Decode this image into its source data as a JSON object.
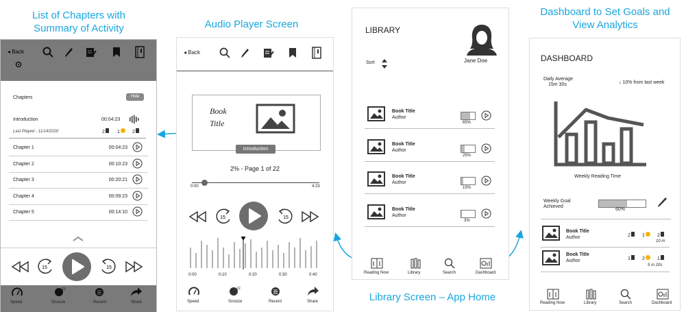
{
  "captions": {
    "chapters": "List of Chapters with\nSummary of Activity",
    "player": "Audio Player Screen",
    "library": "Library Screen – App Home",
    "dashboard": "Dashboard to Set Goals and\nView Analytics"
  },
  "chapters_screen": {
    "back": "Back",
    "title": "Chapters",
    "hide": "Hide",
    "intro": {
      "name": "Introduction",
      "time": "00:04:23",
      "last_played": "Last Played - 11/14/2020",
      "c1": "2",
      "c2": "1",
      "c3": "2"
    },
    "rows": [
      {
        "name": "Chapter 1",
        "time": "00:04:23"
      },
      {
        "name": "Chapter 2",
        "time": "00:10:23"
      },
      {
        "name": "Chapter 3",
        "time": "00:20:21"
      },
      {
        "name": "Chapter 4",
        "time": "00:09:23"
      },
      {
        "name": "Chapter 5",
        "time": "00:14:10"
      }
    ],
    "skip": "15",
    "bottom": [
      "Speed",
      "Snooze",
      "Recent",
      "Share"
    ]
  },
  "player_screen": {
    "back": "Back",
    "book_title": "Book\nTitle",
    "chapter_tag": "Introduction",
    "progress": "2%  - Page 1 of 22",
    "progress_fraction": 0.02,
    "start": "0:00",
    "end": "4:23",
    "skip": "15",
    "ticks": [
      "0:00",
      "0:10",
      "0:20",
      "0:30",
      "0:40"
    ],
    "bottom": [
      "Speed",
      "Snooze",
      "Recent",
      "Share"
    ]
  },
  "library_screen": {
    "title": "LIBRARY",
    "sort": "Sort",
    "user": "Jane Doe",
    "books": [
      {
        "title": "Book Title",
        "author": "Author",
        "pct": "65%",
        "frac": 0.65
      },
      {
        "title": "Book Title",
        "author": "Author",
        "pct": "25%",
        "frac": 0.25
      },
      {
        "title": "Book Title",
        "author": "Author",
        "pct": "15%",
        "frac": 0.15
      },
      {
        "title": "Book Title",
        "author": "Author",
        "pct": "3%",
        "frac": 0.03
      }
    ],
    "nav": [
      "Reading Now",
      "Library",
      "Search",
      "Dashboard"
    ]
  },
  "dashboard_screen": {
    "title": "DASHBOARD",
    "daily_label": "Daily Average",
    "daily_value": "15m 30s",
    "change": "10% from last week",
    "chart_label": "Weekly Reading Time",
    "goal_label": "Weekly Goal\nAchieved",
    "goal_pct": "60%",
    "goal_frac": 0.6,
    "books": [
      {
        "title": "Book Title",
        "author": "Author",
        "c1": "2",
        "c2": "1",
        "c3": "2",
        "time": "10 m"
      },
      {
        "title": "Book Title",
        "author": "Author",
        "c1": "1",
        "c2": "2",
        "c3": "1",
        "time": "5 m 20s"
      }
    ],
    "nav": [
      "Reading Now",
      "Library",
      "Search",
      "Dashboard"
    ]
  },
  "colors": {
    "caption": "#1aa6de",
    "arrow": "#1aa6de",
    "dark_bar": "#7a7a7a",
    "accent_dot": "#f2b400"
  }
}
